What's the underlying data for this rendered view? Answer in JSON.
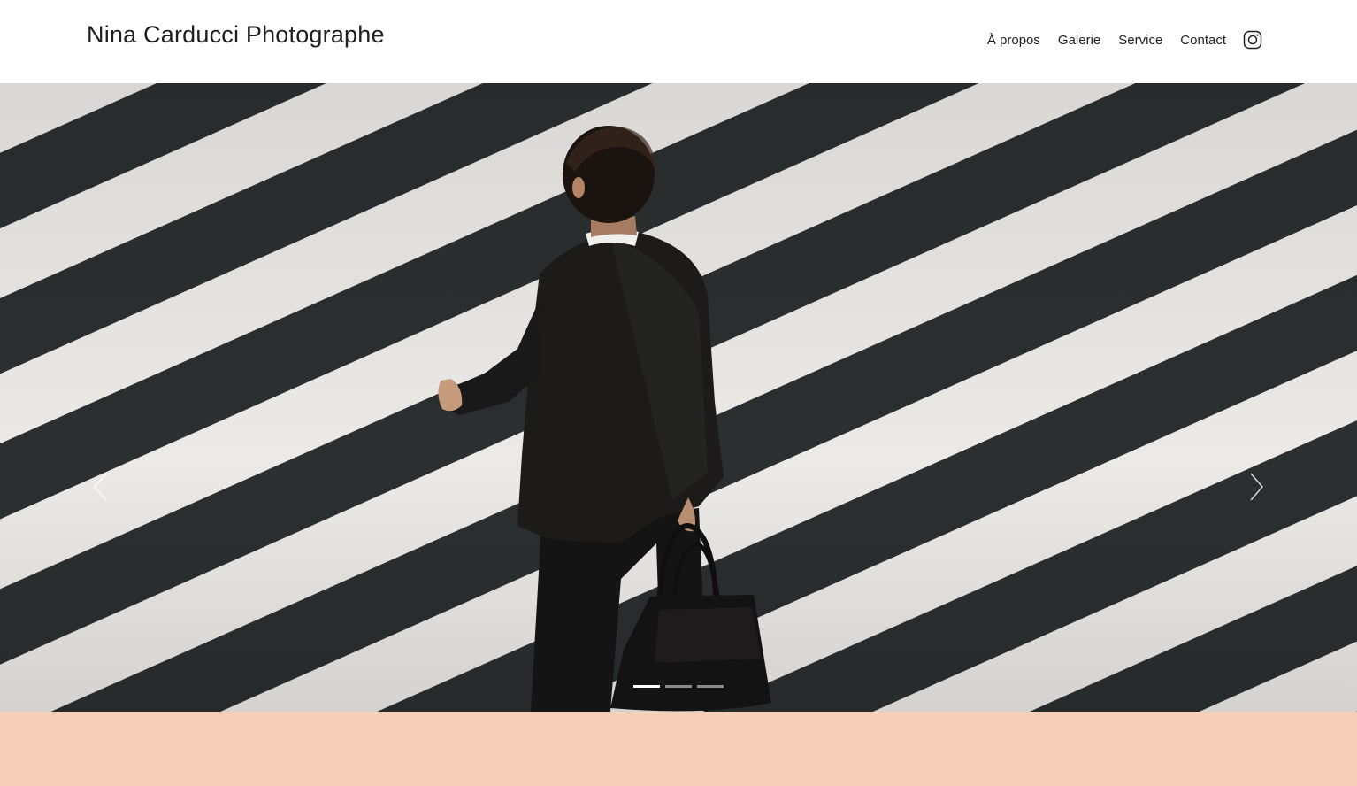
{
  "header": {
    "site_title": "Nina Carducci Photographe",
    "nav": [
      {
        "label": "À propos"
      },
      {
        "label": "Galerie"
      },
      {
        "label": "Service"
      },
      {
        "label": "Contact"
      }
    ],
    "social_icon": "instagram-icon"
  },
  "carousel": {
    "prev_icon": "chevron-left-icon",
    "next_icon": "chevron-right-icon",
    "slide_count": 3,
    "active_index": 0
  },
  "colors": {
    "text": "#1f1f1f",
    "band": "#f5cfb7",
    "stripe_white": "#ecebe9",
    "asphalt": "#2a2e2f"
  }
}
